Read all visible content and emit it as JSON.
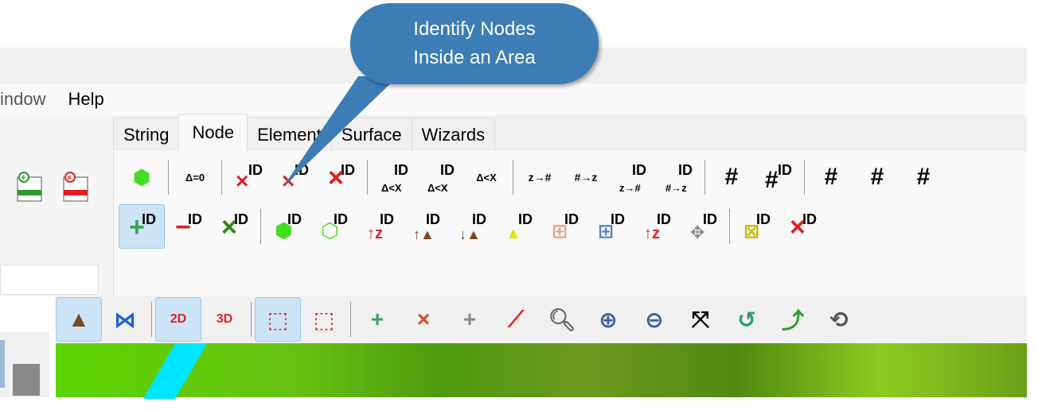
{
  "callout": {
    "line1": "Identify Nodes",
    "line2": "Inside an Area"
  },
  "menu": [
    "indow",
    "Help"
  ],
  "tabs": [
    {
      "label": "String"
    },
    {
      "label": "Node",
      "active": true
    },
    {
      "label": "Element"
    },
    {
      "label": "Surface"
    },
    {
      "label": "Wizards"
    }
  ],
  "ribbon": {
    "row1": [
      "polygon-add-icon",
      "|",
      "delta-zero-icon",
      "|",
      "delete-nodes-inside-icon",
      "delete-nodes-outside-icon",
      "delete-id-icon",
      "|",
      "delta-inside-icon",
      "delta-outside-icon",
      "delta-less-x-icon",
      "|",
      "z-to-label-icon",
      "label-to-z-icon",
      "copy-id-z-to-label-icon",
      "paste-id-label-to-z-icon",
      "|",
      "label-delete-icon",
      "label-delete-grid-icon",
      "|",
      "label-color-icon",
      "label-color-settings-icon",
      "label-settings-icon"
    ],
    "row2": [
      "add-id-icon",
      "remove-id-icon",
      "delete-id-green-icon",
      "|",
      "identify-inside-area-icon",
      "identify-outside-area-icon",
      "identify-raise-z-icon",
      "identify-above-surface-icon",
      "identify-below-surface-icon",
      "identify-triangle-points-icon",
      "identify-grid-red-icon",
      "identify-grid-blue-icon",
      "id-raise-z-icon",
      "id-move-icon",
      "|",
      "id-element-delete-icon",
      "id-delete-red-icon"
    ],
    "id_text": "ID"
  },
  "toolbar": {
    "items": [
      "terrain-icon",
      "contour-icon",
      "|",
      "view-2d-icon",
      "view-3d-icon",
      "|",
      "box-solid-icon",
      "box-wire-icon",
      "|",
      "add-point-icon",
      "delete-point-icon",
      "insert-point-icon",
      "draw-line-icon",
      "zoom-window-icon",
      "zoom-in-icon",
      "zoom-out-icon",
      "zoom-extents-icon",
      "zoom-previous-icon",
      "pan-view-icon",
      "rotate-icon"
    ],
    "labels": {
      "view-2d-icon": "2D",
      "view-3d-icon": "3D"
    }
  },
  "colors": {
    "callout": "#3b7db4",
    "selected": "#cce4f7",
    "red": "#e02020",
    "green": "#3aa35a"
  }
}
